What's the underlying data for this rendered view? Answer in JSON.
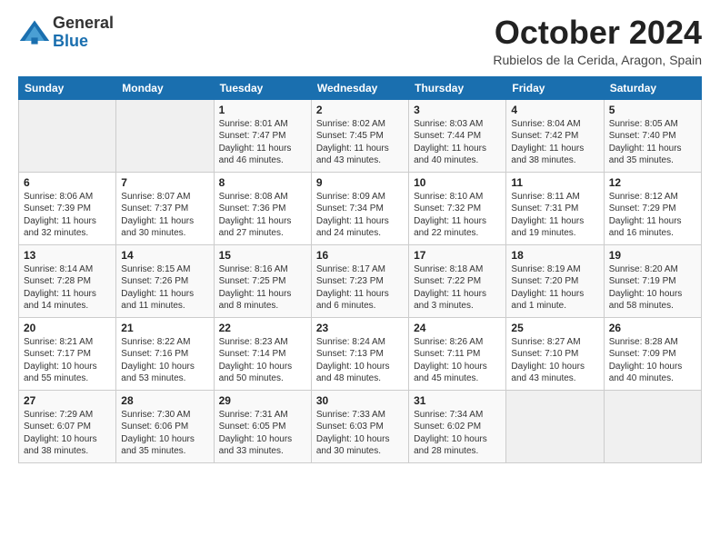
{
  "logo": {
    "general": "General",
    "blue": "Blue"
  },
  "title": "October 2024",
  "location": "Rubielos de la Cerida, Aragon, Spain",
  "days_of_week": [
    "Sunday",
    "Monday",
    "Tuesday",
    "Wednesday",
    "Thursday",
    "Friday",
    "Saturday"
  ],
  "weeks": [
    [
      {
        "day": "",
        "content": ""
      },
      {
        "day": "",
        "content": ""
      },
      {
        "day": "1",
        "content": "Sunrise: 8:01 AM\nSunset: 7:47 PM\nDaylight: 11 hours and 46 minutes."
      },
      {
        "day": "2",
        "content": "Sunrise: 8:02 AM\nSunset: 7:45 PM\nDaylight: 11 hours and 43 minutes."
      },
      {
        "day": "3",
        "content": "Sunrise: 8:03 AM\nSunset: 7:44 PM\nDaylight: 11 hours and 40 minutes."
      },
      {
        "day": "4",
        "content": "Sunrise: 8:04 AM\nSunset: 7:42 PM\nDaylight: 11 hours and 38 minutes."
      },
      {
        "day": "5",
        "content": "Sunrise: 8:05 AM\nSunset: 7:40 PM\nDaylight: 11 hours and 35 minutes."
      }
    ],
    [
      {
        "day": "6",
        "content": "Sunrise: 8:06 AM\nSunset: 7:39 PM\nDaylight: 11 hours and 32 minutes."
      },
      {
        "day": "7",
        "content": "Sunrise: 8:07 AM\nSunset: 7:37 PM\nDaylight: 11 hours and 30 minutes."
      },
      {
        "day": "8",
        "content": "Sunrise: 8:08 AM\nSunset: 7:36 PM\nDaylight: 11 hours and 27 minutes."
      },
      {
        "day": "9",
        "content": "Sunrise: 8:09 AM\nSunset: 7:34 PM\nDaylight: 11 hours and 24 minutes."
      },
      {
        "day": "10",
        "content": "Sunrise: 8:10 AM\nSunset: 7:32 PM\nDaylight: 11 hours and 22 minutes."
      },
      {
        "day": "11",
        "content": "Sunrise: 8:11 AM\nSunset: 7:31 PM\nDaylight: 11 hours and 19 minutes."
      },
      {
        "day": "12",
        "content": "Sunrise: 8:12 AM\nSunset: 7:29 PM\nDaylight: 11 hours and 16 minutes."
      }
    ],
    [
      {
        "day": "13",
        "content": "Sunrise: 8:14 AM\nSunset: 7:28 PM\nDaylight: 11 hours and 14 minutes."
      },
      {
        "day": "14",
        "content": "Sunrise: 8:15 AM\nSunset: 7:26 PM\nDaylight: 11 hours and 11 minutes."
      },
      {
        "day": "15",
        "content": "Sunrise: 8:16 AM\nSunset: 7:25 PM\nDaylight: 11 hours and 8 minutes."
      },
      {
        "day": "16",
        "content": "Sunrise: 8:17 AM\nSunset: 7:23 PM\nDaylight: 11 hours and 6 minutes."
      },
      {
        "day": "17",
        "content": "Sunrise: 8:18 AM\nSunset: 7:22 PM\nDaylight: 11 hours and 3 minutes."
      },
      {
        "day": "18",
        "content": "Sunrise: 8:19 AM\nSunset: 7:20 PM\nDaylight: 11 hours and 1 minute."
      },
      {
        "day": "19",
        "content": "Sunrise: 8:20 AM\nSunset: 7:19 PM\nDaylight: 10 hours and 58 minutes."
      }
    ],
    [
      {
        "day": "20",
        "content": "Sunrise: 8:21 AM\nSunset: 7:17 PM\nDaylight: 10 hours and 55 minutes."
      },
      {
        "day": "21",
        "content": "Sunrise: 8:22 AM\nSunset: 7:16 PM\nDaylight: 10 hours and 53 minutes."
      },
      {
        "day": "22",
        "content": "Sunrise: 8:23 AM\nSunset: 7:14 PM\nDaylight: 10 hours and 50 minutes."
      },
      {
        "day": "23",
        "content": "Sunrise: 8:24 AM\nSunset: 7:13 PM\nDaylight: 10 hours and 48 minutes."
      },
      {
        "day": "24",
        "content": "Sunrise: 8:26 AM\nSunset: 7:11 PM\nDaylight: 10 hours and 45 minutes."
      },
      {
        "day": "25",
        "content": "Sunrise: 8:27 AM\nSunset: 7:10 PM\nDaylight: 10 hours and 43 minutes."
      },
      {
        "day": "26",
        "content": "Sunrise: 8:28 AM\nSunset: 7:09 PM\nDaylight: 10 hours and 40 minutes."
      }
    ],
    [
      {
        "day": "27",
        "content": "Sunrise: 7:29 AM\nSunset: 6:07 PM\nDaylight: 10 hours and 38 minutes."
      },
      {
        "day": "28",
        "content": "Sunrise: 7:30 AM\nSunset: 6:06 PM\nDaylight: 10 hours and 35 minutes."
      },
      {
        "day": "29",
        "content": "Sunrise: 7:31 AM\nSunset: 6:05 PM\nDaylight: 10 hours and 33 minutes."
      },
      {
        "day": "30",
        "content": "Sunrise: 7:33 AM\nSunset: 6:03 PM\nDaylight: 10 hours and 30 minutes."
      },
      {
        "day": "31",
        "content": "Sunrise: 7:34 AM\nSunset: 6:02 PM\nDaylight: 10 hours and 28 minutes."
      },
      {
        "day": "",
        "content": ""
      },
      {
        "day": "",
        "content": ""
      }
    ]
  ]
}
